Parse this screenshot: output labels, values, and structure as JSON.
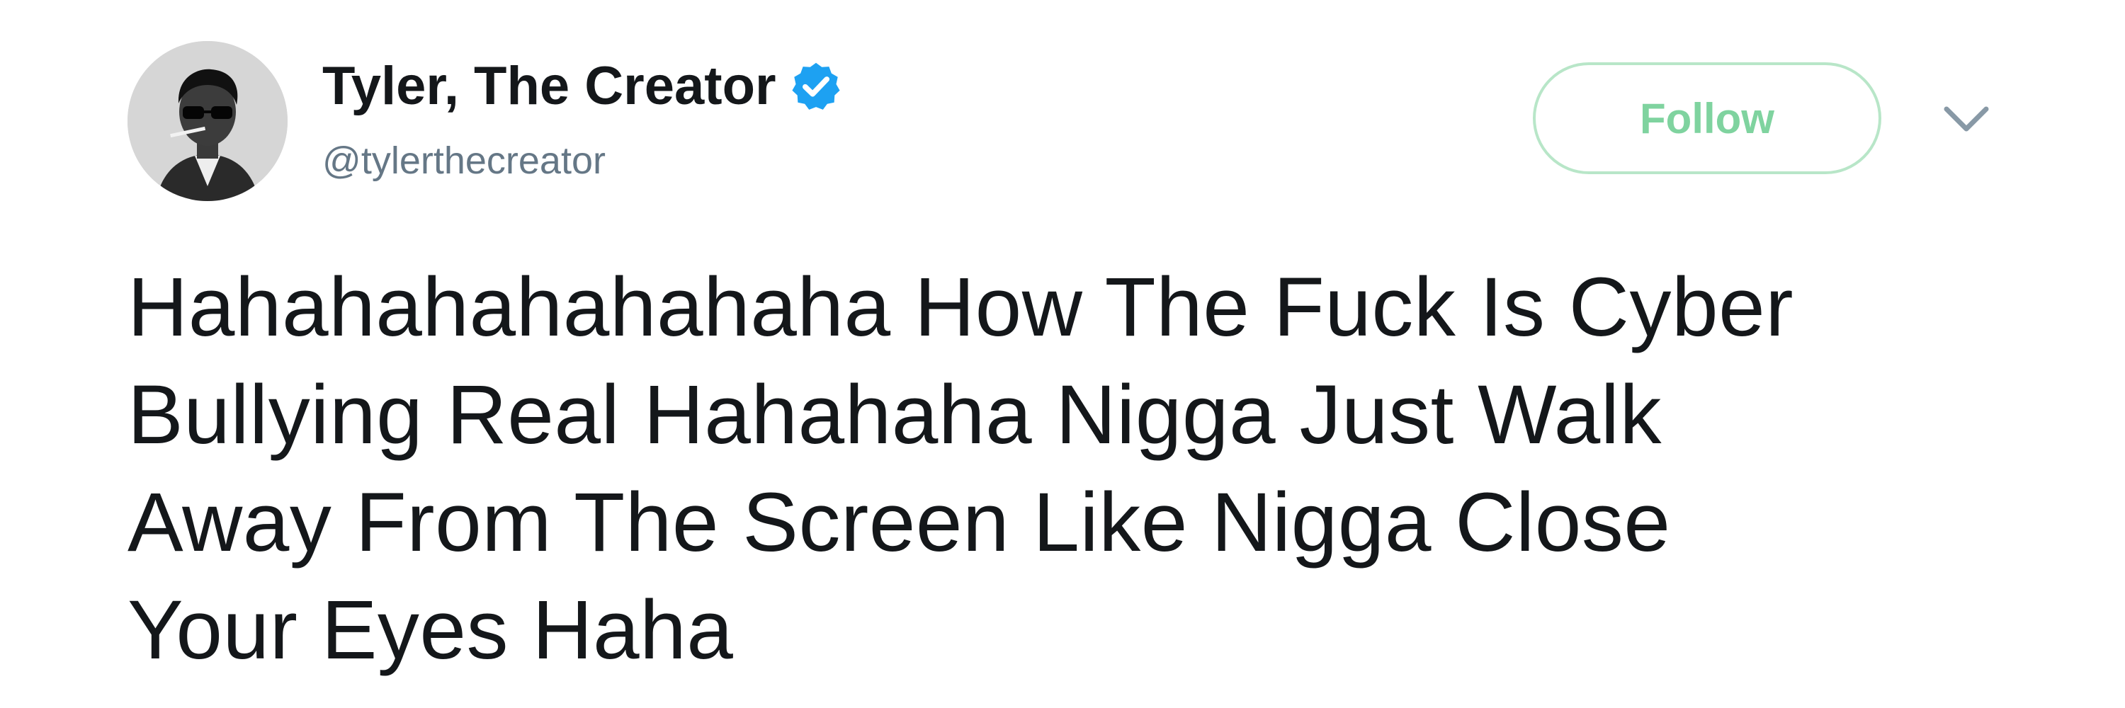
{
  "author": {
    "display_name": "Tyler, The Creator",
    "handle": "@tylerthecreator",
    "verified_icon": "verified-badge-icon",
    "avatar_icon": "avatar-portrait"
  },
  "actions": {
    "follow_label": "Follow",
    "menu_icon": "chevron-down-icon"
  },
  "tweet": {
    "lines": [
      "Hahahahahahahaha How The Fuck Is Cyber",
      "Bullying Real Hahahaha Nigga Just Walk",
      "Away From The Screen Like Nigga Close",
      "Your Eyes Haha"
    ]
  },
  "colors": {
    "verified_blue": "#1da1f2",
    "follow_text": "#7fd39f",
    "follow_border": "#b8e6c8",
    "handle_gray": "#657786",
    "text_dark": "#14171a"
  }
}
